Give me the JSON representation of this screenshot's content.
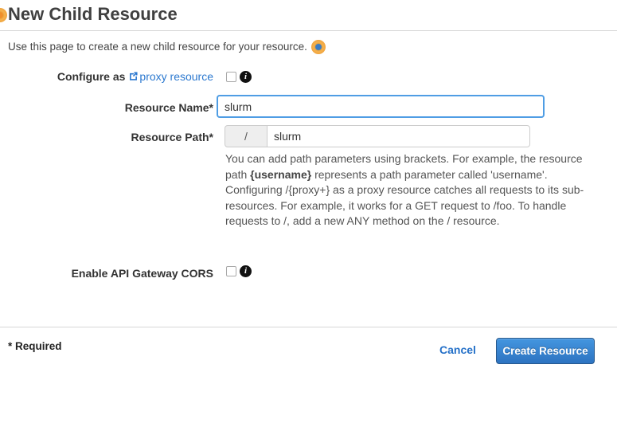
{
  "header": {
    "title": "New Child Resource"
  },
  "intro": {
    "text": "Use this page to create a new child resource for your resource."
  },
  "form": {
    "configure_as": {
      "label": "Configure as",
      "link_label": "proxy resource",
      "checkbox_checked": false
    },
    "resource_name": {
      "label": "Resource Name*",
      "value": "slurm"
    },
    "resource_path": {
      "label": "Resource Path*",
      "prefix": "/",
      "value": "slurm"
    },
    "path_help": {
      "part1": "You can add path parameters using brackets. For example, the resource\npath ",
      "bold": "{username}",
      "part2": " represents a path parameter called 'username'.\nConfiguring /{proxy+} as a proxy resource catches all requests to its sub-\nresources. For example, it works for a GET request to /foo. To handle\nrequests to /, add a new ANY method on the / resource."
    },
    "enable_cors": {
      "label": "Enable API Gateway CORS",
      "checkbox_checked": false
    }
  },
  "footer": {
    "required_note": "* Required",
    "cancel_label": "Cancel",
    "create_label": "Create Resource"
  },
  "icons": {
    "info_icon": "i",
    "external_link_icon": "arrow-out-of-box",
    "hint_beacon": "orange-ring-blue-dot"
  },
  "colors": {
    "link_blue": "#2b78cf",
    "button_gradient_top": "#4496e0",
    "button_gradient_bottom": "#2d73c1",
    "focus_border": "#4f9de4",
    "beacon_orange": "#efa43c",
    "beacon_blue": "#3a7cc4"
  }
}
